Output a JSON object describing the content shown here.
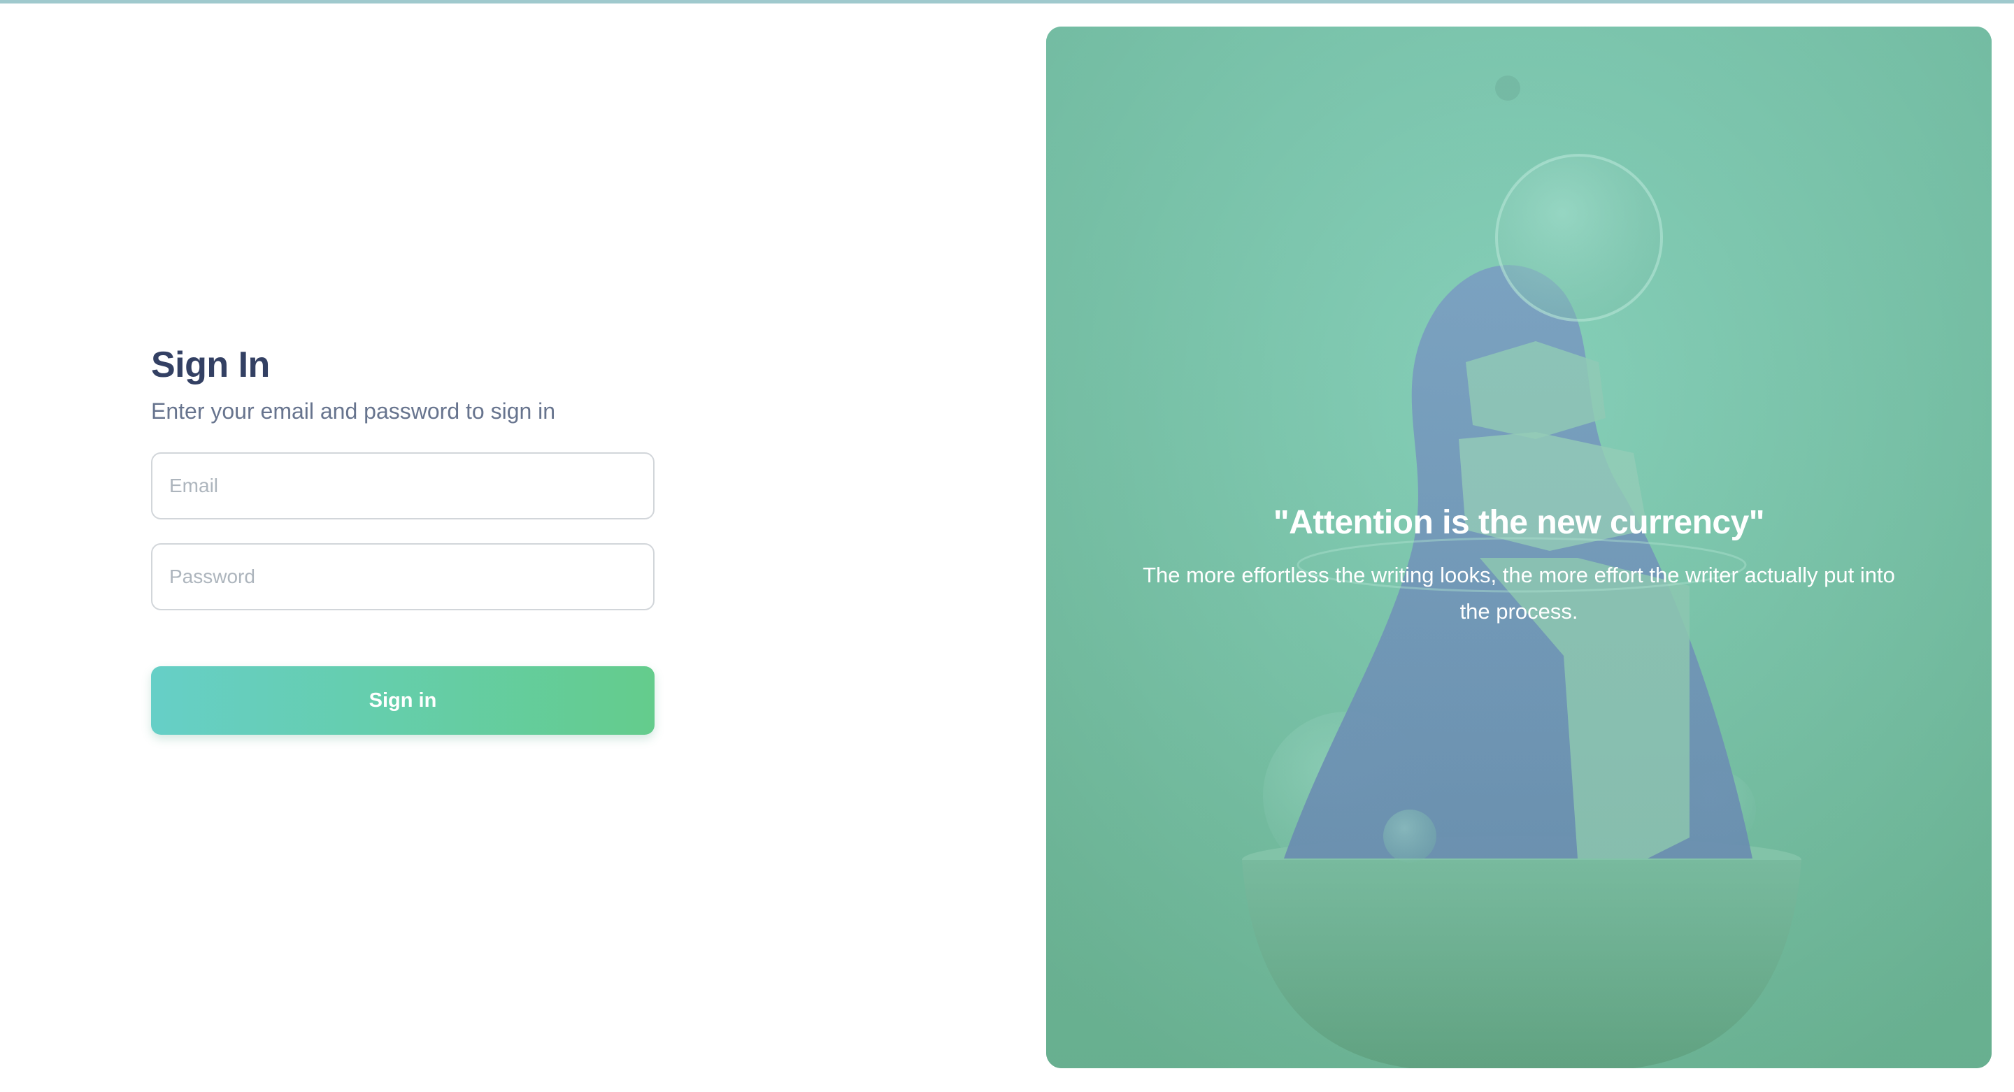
{
  "signin": {
    "title": "Sign In",
    "subtitle": "Enter your email and password to sign in",
    "email_placeholder": "Email",
    "password_placeholder": "Password",
    "submit_label": "Sign in"
  },
  "hero": {
    "quote": "\"Attention is the new currency\"",
    "body": "The more effortless the writing looks, the more effort the writer actually put into the process."
  },
  "colors": {
    "accent_start": "#66cfc7",
    "accent_end": "#64cc8c",
    "heading": "#334063",
    "subtitle": "#67748e",
    "hero_base": "#86c9b6"
  }
}
